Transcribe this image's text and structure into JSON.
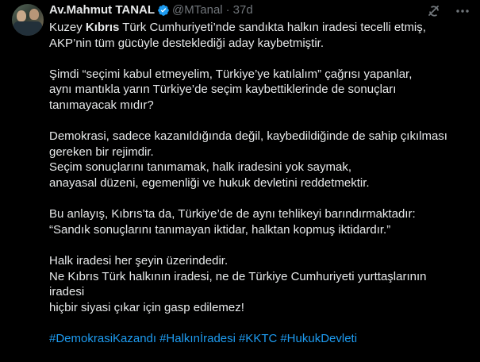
{
  "author": {
    "name": "Av.Mahmut TANAL",
    "handle": "@MTanal",
    "separator": "·",
    "time": "37d"
  },
  "icons": {
    "verified": "verified-badge-icon",
    "grok": "grok-icon",
    "more": "more-options-icon",
    "verified_color": "#1d9bf0"
  },
  "tweet": {
    "p1": {
      "l1_pre": "Kuzey ",
      "l1_bold": "Kıbrıs",
      "l1_post": " Türk Cumhuriyeti’nde sandıkta halkın iradesi tecelli etmiş,",
      "l2": "AKP’nin tüm gücüyle desteklediği aday kaybetmiştir."
    },
    "p2": {
      "l1": "Şimdi “seçimi kabul etmeyelim, Türkiye’ye katılalım” çağrısı yapanlar,",
      "l2": "aynı mantıkla yarın Türkiye’de seçim kaybettiklerinde de sonuçları",
      "l3": "tanımayacak mıdır?"
    },
    "p3": {
      "l1": "Demokrasi, sadece kazanıldığında değil, kaybedildiğinde de sahip çıkılması",
      "l2": "gereken bir rejimdir.",
      "l3": "Seçim sonuçlarını tanımamak, halk iradesini yok saymak,",
      "l4": "anayasal düzeni, egemenliği ve hukuk devletini reddetmektir."
    },
    "p4": {
      "l1": "Bu anlayış, Kıbrıs’ta da, Türkiye’de de aynı tehlikeyi barındırmaktadır:",
      "l2": "“Sandık sonuçlarını tanımayan iktidar, halktan kopmuş iktidardır.”"
    },
    "p5": {
      "l1": "Halk iradesi her şeyin üzerindedir.",
      "l2": "Ne Kıbrıs Türk halkının iradesi, ne de Türkiye Cumhuriyeti yurttaşlarının",
      "l3": "iradesi",
      "l4": "hiçbir siyasi çıkar için gasp edilemez!"
    },
    "hashtags": [
      "#DemokrasiKazandı",
      "#Halkınİradesi",
      "#KKTC",
      "#HukukDevleti"
    ]
  }
}
